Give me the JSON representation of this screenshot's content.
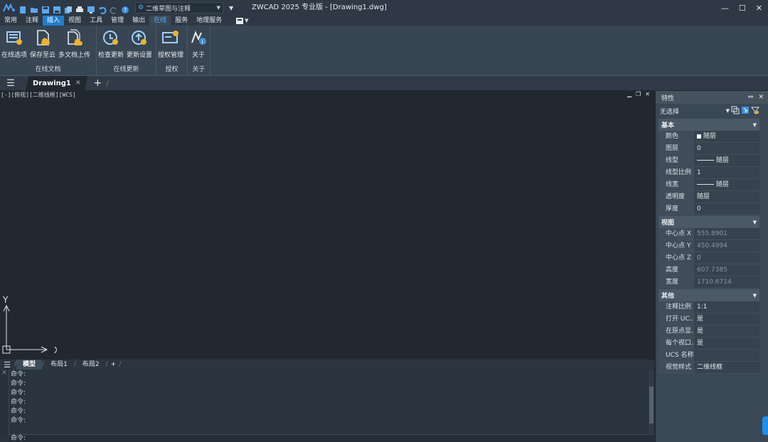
{
  "app": {
    "title": "ZWCAD 2025 专业版 - [Drawing1.dwg]",
    "workspace": "二维草图与注释",
    "window_controls": {
      "minimize": "—",
      "maximize": "☐",
      "close": "✕"
    }
  },
  "menu": {
    "items": [
      "常用",
      "注释",
      "插入",
      "视图",
      "工具",
      "管理",
      "输出",
      "在线",
      "服务",
      "地理服务"
    ],
    "active_index": 2,
    "highlight_index": 7
  },
  "ribbon": {
    "panels": [
      {
        "title": "在线文档",
        "buttons": [
          "在线选项",
          "保存至云",
          "多文档上传"
        ]
      },
      {
        "title": "在线更新",
        "buttons": [
          "检查更新",
          "更新设置"
        ]
      },
      {
        "title": "授权",
        "buttons": [
          "授权管理"
        ]
      },
      {
        "title": "关于",
        "buttons": [
          "关于"
        ]
      }
    ]
  },
  "doc_tabs": {
    "tab": "Drawing1",
    "close": "✕",
    "add": "+"
  },
  "viewport": {
    "label": "[-][俯视][二维线框][WCS]",
    "axis_x": "X",
    "axis_y": "Y"
  },
  "layout_tabs": {
    "tabs": [
      "模型",
      "布局1",
      "布局2"
    ],
    "add": "+"
  },
  "command": {
    "history": [
      "命令:",
      "命令:",
      "命令:",
      "命令:",
      "命令:",
      "命令:"
    ],
    "prompt": "命令:"
  },
  "properties": {
    "title": "特性",
    "selection": "无选择",
    "sections": {
      "basic": {
        "title": "基本",
        "rows": [
          {
            "key": "颜色",
            "value": "随层"
          },
          {
            "key": "图层",
            "value": "0"
          },
          {
            "key": "线型",
            "value": "随层"
          },
          {
            "key": "线型比例",
            "value": "1"
          },
          {
            "key": "线宽",
            "value": "随层"
          },
          {
            "key": "透明度",
            "value": "随层"
          },
          {
            "key": "厚度",
            "value": "0"
          }
        ]
      },
      "view": {
        "title": "视图",
        "rows": [
          {
            "key": "中心点 X",
            "value": "555.8901"
          },
          {
            "key": "中心点 Y",
            "value": "450.4994"
          },
          {
            "key": "中心点 Z",
            "value": "0"
          },
          {
            "key": "高度",
            "value": "607.7385"
          },
          {
            "key": "宽度",
            "value": "1710.6714"
          }
        ]
      },
      "misc": {
        "title": "其他",
        "rows": [
          {
            "key": "注释比例",
            "value": "1:1"
          },
          {
            "key": "打开 UC...",
            "value": "是"
          },
          {
            "key": "在原点显...",
            "value": "是"
          },
          {
            "key": "每个视口...",
            "value": "是"
          },
          {
            "key": "UCS 名称",
            "value": ""
          },
          {
            "key": "视觉样式",
            "value": "二维线框"
          }
        ]
      }
    }
  },
  "colors": {
    "accent": "#1e7fd0",
    "online_tab": "#4fb0ff",
    "canvas": "#212830"
  }
}
